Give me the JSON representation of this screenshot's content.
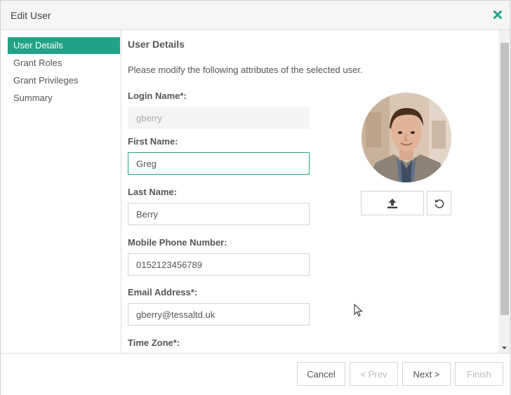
{
  "dialog": {
    "title": "Edit User"
  },
  "sidebar": {
    "items": [
      {
        "label": "User Details",
        "active": true
      },
      {
        "label": "Grant Roles",
        "active": false
      },
      {
        "label": "Grant Privileges",
        "active": false
      },
      {
        "label": "Summary",
        "active": false
      }
    ]
  },
  "main": {
    "heading": "User Details",
    "description": "Please modify the following attributes of the selected user.",
    "fields": {
      "login": {
        "label": "Login Name*:",
        "value": "gberry",
        "disabled": true
      },
      "first_name": {
        "label": "First Name:",
        "value": "Greg",
        "focused": true
      },
      "last_name": {
        "label": "Last Name:",
        "value": "Berry"
      },
      "mobile": {
        "label": "Mobile Phone Number:",
        "value": "0152123456789"
      },
      "email": {
        "label": "Email Address*:",
        "value": "gberry@tessaltd.uk"
      },
      "timezone": {
        "label": "Time Zone*:"
      }
    },
    "avatar": {
      "upload_icon": "upload-icon",
      "reset_icon": "undo-icon"
    }
  },
  "footer": {
    "cancel": "Cancel",
    "prev": "< Prev",
    "next": "Next >",
    "finish": "Finish"
  },
  "colors": {
    "accent": "#23a287",
    "close_icon": "#1fa384"
  }
}
